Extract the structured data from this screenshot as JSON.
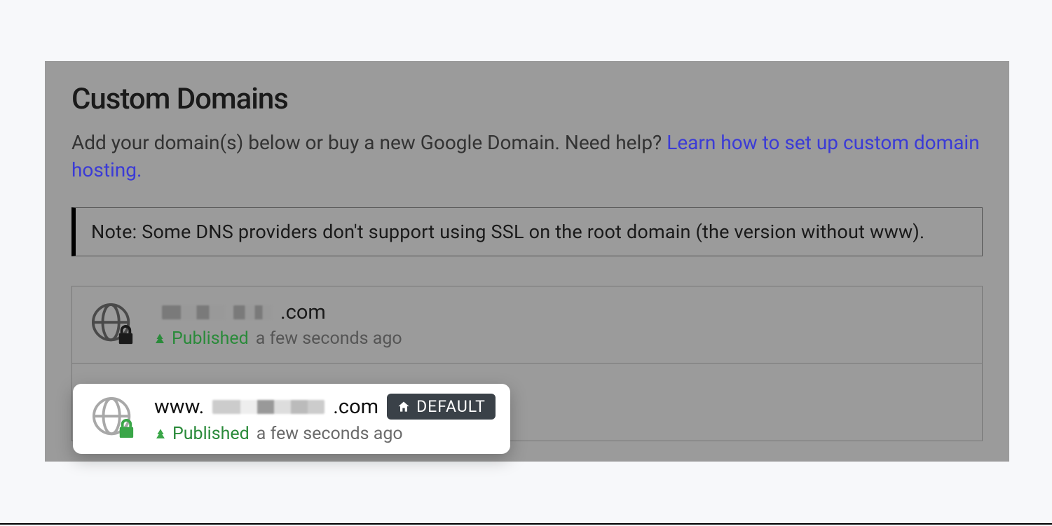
{
  "header": {
    "title": "Custom Domains",
    "subtext_prefix": "Add your domain(s) below or buy a new Google Domain. Need help? ",
    "subtext_link": "Learn how to set up custom domain hosting."
  },
  "note": {
    "text": "Note: Some DNS providers don't support using SSL on the root domain (the version without www)."
  },
  "domains": [
    {
      "prefix": "",
      "suffix": ".com",
      "status": "Published",
      "time": "a few seconds ago",
      "is_default": false,
      "lock_color": "dark"
    },
    {
      "prefix": "www.",
      "suffix": ".com",
      "status": "Published",
      "time": "a few seconds ago",
      "is_default": true,
      "default_label": "DEFAULT",
      "lock_color": "green"
    }
  ]
}
